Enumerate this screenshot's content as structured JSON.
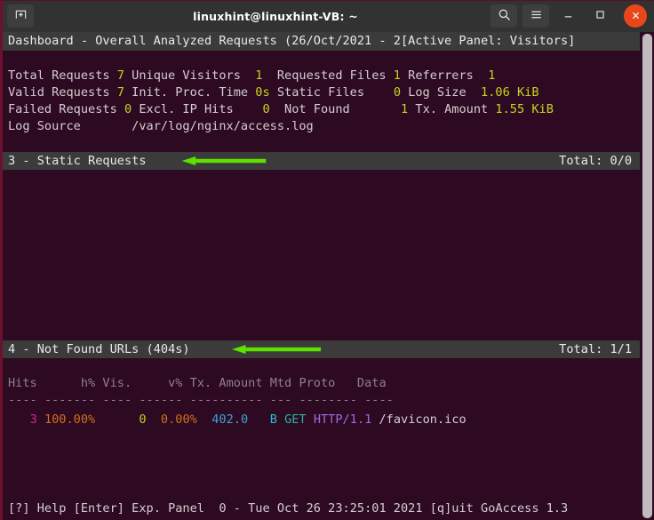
{
  "window": {
    "title": "linuxhint@linuxhint-VB: ~",
    "new_tab_icon": "new-tab-icon",
    "search_icon": "search-icon",
    "menu_icon": "hamburger-menu-icon",
    "minimize_icon": "minimize-icon",
    "maximize_icon": "maximize-icon",
    "close_icon": "close-icon",
    "accent_close": "#e8471c",
    "titlebar_bg": "#323232"
  },
  "terminal": {
    "bg": "#2d0922",
    "panel_bar_bg": "#3b3b3b",
    "annotation_color": "#5ee000"
  },
  "dashboard": {
    "header": "Dashboard - Overall Analyzed Requests (26/Oct/2021 - 2[Active Panel: Visitors]",
    "stats": {
      "row1": {
        "l1": "Total Requests",
        "v1": "7",
        "l2": "Unique Visitors",
        "v2": "1",
        "l3": "Requested Files",
        "v3": "1",
        "l4": "Referrers",
        "v4": "1"
      },
      "row2": {
        "l1": "Valid Requests",
        "v1": "7",
        "l2": "Init. Proc. Time",
        "v2": "0s",
        "l3": "Static Files",
        "v3": "0",
        "l4": "Log Size",
        "v4": "1.06 KiB"
      },
      "row3": {
        "l1": "Failed Requests",
        "v1": "0",
        "l2": "Excl. IP Hits",
        "v2": "0",
        "l3": "Not Found",
        "v3": "1",
        "l4": "Tx. Amount",
        "v4": "1.55 KiB"
      },
      "row4": {
        "l1": "Log Source",
        "v1": "/var/log/nginx/access.log"
      }
    },
    "panels": [
      {
        "index": "3",
        "separator": "-",
        "name": "Static Requests",
        "total_label": "Total: 0/0",
        "annotated": true,
        "rows": []
      },
      {
        "index": "4",
        "separator": "-",
        "name": "Not Found URLs (404s)",
        "total_label": "Total: 1/1",
        "annotated": true,
        "columns": [
          "Hits",
          "h%",
          "Vis.",
          "v%",
          "Tx. Amount",
          "Mtd",
          "Proto",
          "Data"
        ],
        "column_rules": [
          "----",
          "-------",
          "----",
          "------",
          "----------",
          "---",
          "--------",
          "----"
        ],
        "rows": [
          {
            "hits": "3",
            "hits_pct": "100.00%",
            "vis": "0",
            "vis_pct": "0.00%",
            "tx_amount": "402.0",
            "tx_unit": "B",
            "method": "GET",
            "protocol": "HTTP/1.1",
            "data": "/favicon.ico"
          }
        ]
      }
    ],
    "footer": {
      "help": "[?] Help",
      "expand": "[Enter] Exp. Panel",
      "active": "0",
      "dash": "-",
      "timestamp": "Tue Oct 26 23:25:01 2021",
      "quit": "[q]uit",
      "program": "GoAccess 1.3"
    }
  }
}
